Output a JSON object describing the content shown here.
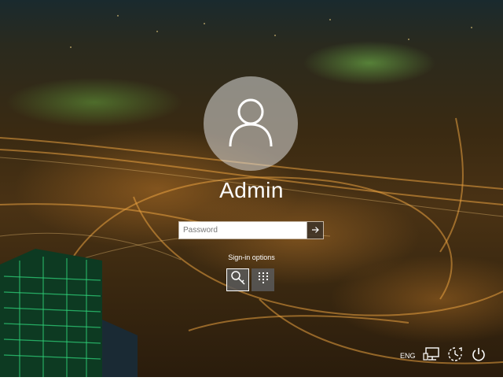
{
  "user": {
    "name": "Admin"
  },
  "password": {
    "placeholder": "Password",
    "value": ""
  },
  "signin_options": {
    "label": "Sign-in options",
    "options": [
      "password-key-icon",
      "pin-keypad-icon"
    ]
  },
  "tray": {
    "language": "ENG",
    "icons": [
      "network-icon",
      "ease-of-access-icon",
      "power-icon"
    ]
  },
  "colors": {
    "avatar_bg": "#dcdcdc",
    "submit_bg": "#3c3228"
  }
}
